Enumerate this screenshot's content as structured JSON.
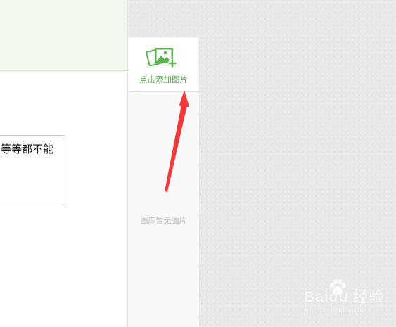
{
  "editor": {
    "text_box_content": "等等都不能"
  },
  "library": {
    "add_image_label": "点击添加图片",
    "empty_text": "图库暂无图片"
  },
  "watermark": {
    "brand": "Baidu 经验",
    "url": "jingyan.baidu.com"
  },
  "icons": {
    "add_image": "image-add-icon",
    "annotation": "red-arrow",
    "watermark": "baidu-paw-icon"
  },
  "colors": {
    "accent_green": "#55a84a",
    "arrow_red": "#f03a3a",
    "header_green": "#f2f9ef"
  }
}
